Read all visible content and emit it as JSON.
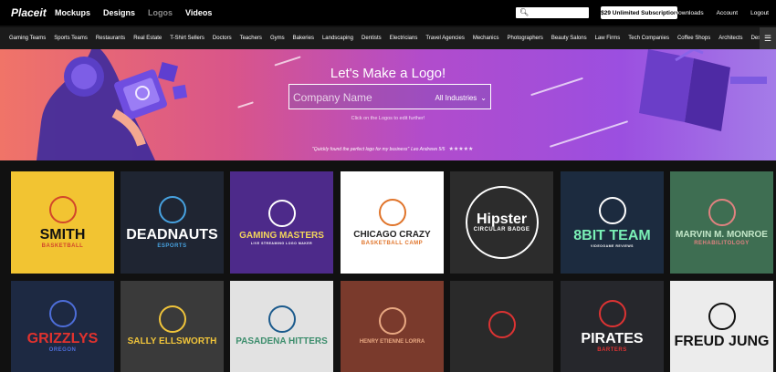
{
  "topbar": {
    "logo": "Placeit",
    "nav": [
      "Mockups",
      "Designs",
      "Logos",
      "Videos"
    ],
    "active_nav": "Logos",
    "subscription": "$29 Unlimited Subscription",
    "links": [
      "Downloads",
      "Account",
      "Logout"
    ]
  },
  "categories": [
    "Gaming Teams",
    "Sports Teams",
    "Restaurants",
    "Real Estate",
    "T-Shirt Sellers",
    "Doctors",
    "Teachers",
    "Gyms",
    "Bakeries",
    "Landscaping",
    "Dentists",
    "Electricians",
    "Travel Agencies",
    "Mechanics",
    "Photographers",
    "Beauty Salons",
    "Law Firms",
    "Tech Companies",
    "Coffee Shops",
    "Architects",
    "Desi"
  ],
  "hero": {
    "title": "Let's Make a Logo!",
    "input_placeholder": "Company Name",
    "industry_label": "All Industries",
    "hint": "Click on the Logos to edit further!",
    "quote": "\"Quickly found the perfect logo for my business\"",
    "quote_author": "Leo Andrews 5/5",
    "stars": "★★★★★"
  },
  "tiles": [
    {
      "line1": "SMITH",
      "line2": "BASKETBALL",
      "bg": "#f2c432",
      "fg": "#111",
      "accent": "#d2462a"
    },
    {
      "line1": "DEADNAUTS",
      "line2": "ESPORTS",
      "bg": "#1f2532",
      "fg": "#ffffff",
      "accent": "#47a2e0"
    },
    {
      "line1": "GAMING MASTERS",
      "line2": "LIVE STREAMING LOGO MAKER",
      "bg": "#4d2a8a",
      "fg": "#f3d55b",
      "accent": "#ffffff"
    },
    {
      "line1": "CHICAGO CRAZY",
      "line2": "BASKETBALL CAMP",
      "bg": "#ffffff",
      "fg": "#222222",
      "accent": "#e0742a"
    },
    {
      "line1": "Hipster",
      "line2": "CIRCULAR BADGE",
      "bg": "#2c2c2c",
      "fg": "#ffffff",
      "accent": "#ffffff"
    },
    {
      "line1": "8BIT TEAM",
      "line2": "VIDEOGAME REVIEWS",
      "bg": "#1c2b3f",
      "fg": "#7af0b6",
      "accent": "#ffffff"
    },
    {
      "line1": "MARVIN M. MONROE",
      "line2": "REHABILITOLOGY",
      "bg": "#3e6e52",
      "fg": "#c3e7c8",
      "accent": "#e08280"
    },
    {
      "line1": "GRIZZLYS",
      "line2": "OREGON",
      "bg": "#1d2942",
      "fg": "#e0322e",
      "accent": "#4d6dd8"
    },
    {
      "line1": "SALLY ELLSWORTH",
      "line2": "",
      "bg": "#3a3a3a",
      "fg": "#f0c43a",
      "accent": "#f0c43a"
    },
    {
      "line1": "PASADENA HITTERS",
      "line2": "",
      "bg": "#e2e2e2",
      "fg": "#3c8d6c",
      "accent": "#1b5a8c"
    },
    {
      "line1": "HENRY ETIENNE LORRA",
      "line2": "",
      "bg": "#7a3a2c",
      "fg": "#e8a882",
      "accent": "#e8a882"
    },
    {
      "line1": "",
      "line2": "",
      "bg": "#2a2a2a",
      "fg": "#ffffff",
      "accent": "#d33"
    },
    {
      "line1": "PIRATES",
      "line2": "BARTERS",
      "bg": "#26272c",
      "fg": "#ffffff",
      "accent": "#d33"
    },
    {
      "line1": "FREUD JUNG",
      "line2": "",
      "bg": "#ececec",
      "fg": "#111111",
      "accent": "#111111"
    }
  ]
}
